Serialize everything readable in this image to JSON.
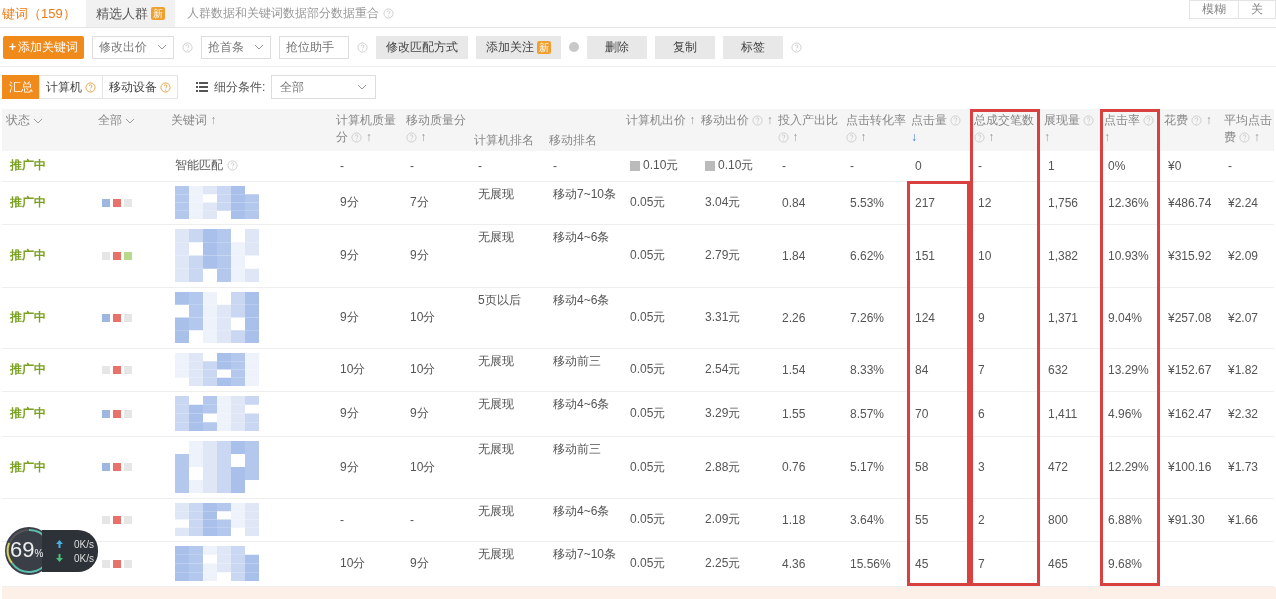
{
  "tabs": [
    {
      "label": "键词（159）",
      "selected": true
    },
    {
      "label": "精选人群",
      "selected": false,
      "badge": "新"
    }
  ],
  "tab_note": "人群数据和关键词数据部分数据重合",
  "match_toggle": [
    {
      "label": "模糊",
      "selected": false
    },
    {
      "label": "关",
      "selected": false
    }
  ],
  "toolbar": [
    {
      "kind": "primary",
      "label": "添加关键词",
      "icon": "+"
    },
    {
      "kind": "dropdown",
      "label": "修改出价"
    },
    {
      "kind": "help"
    },
    {
      "kind": "dropdown",
      "label": "抢首条"
    },
    {
      "kind": "field",
      "placeholder": "抢位助手"
    },
    {
      "kind": "help"
    },
    {
      "kind": "button",
      "label": "修改匹配方式"
    },
    {
      "kind": "button",
      "label": "添加关注",
      "badge": "新"
    },
    {
      "kind": "dot"
    },
    {
      "kind": "button",
      "label": "删除"
    },
    {
      "kind": "button",
      "label": "复制"
    },
    {
      "kind": "button",
      "label": "标签"
    },
    {
      "kind": "help"
    }
  ],
  "device_tabs": [
    {
      "label": "汇总",
      "selected": true,
      "help": false
    },
    {
      "label": "计算机",
      "selected": false,
      "help": true
    },
    {
      "label": "移动设备",
      "selected": false,
      "help": true
    }
  ],
  "filter": {
    "label": "细分条件:",
    "value": "全部"
  },
  "table": {
    "lead_columns": [
      {
        "label": "状态",
        "kind": "dropdown"
      },
      {
        "label": "全部",
        "kind": "dropdown"
      },
      {
        "label": "关键词",
        "sort": "↑"
      }
    ],
    "columns": [
      {
        "label": "计算机质量分",
        "help": true,
        "sort": "↑"
      },
      {
        "label": "移动质量分",
        "help": true,
        "sort": "↑"
      },
      {
        "label": "计算机排名",
        "kind": "sub"
      },
      {
        "label": "移动排名",
        "kind": "sub"
      },
      {
        "label": "计算机出价",
        "sort": "↑"
      },
      {
        "label": "移动出价",
        "help": true,
        "sort": "↑"
      },
      {
        "label": "投入产出比",
        "help": true,
        "sort": "↑"
      },
      {
        "label": "点击转化率",
        "help": true,
        "sort": "↑"
      },
      {
        "label": "点击量",
        "help": true,
        "sort": "↓",
        "sorted": true,
        "highlighted": true,
        "header_highlighted": false
      },
      {
        "label": "总成交笔数",
        "help": true,
        "sort": "↑",
        "highlighted": true,
        "header_highlighted": true
      },
      {
        "label": "展现量",
        "help": true,
        "sort": "↑"
      },
      {
        "label": "点击率",
        "help": true,
        "sort": "↑",
        "highlighted": true,
        "header_highlighted": true
      },
      {
        "label": "花费",
        "help": true,
        "sort": "↑"
      },
      {
        "label": "平均点击费",
        "help": true,
        "sort": "↑"
      }
    ],
    "rows": [
      {
        "status": "推广中",
        "marks": [],
        "keyword": {
          "kind": "text",
          "text": "智能匹配",
          "help": true
        },
        "cells": [
          "-",
          "-",
          "-",
          "-",
          "0.10元",
          "0.10元",
          "-",
          "-",
          "0",
          "-",
          "1",
          "0%",
          "¥0",
          "-"
        ],
        "price_icons": true
      },
      {
        "status": "推广中",
        "marks": [
          {
            "color": "#9fb6e0"
          },
          {
            "color": "#e8726a"
          },
          {
            "color": "#e6e6e6"
          }
        ],
        "keyword": {
          "kind": "blurred"
        },
        "cells": [
          "9分",
          "7分",
          "无展现",
          "移动7~10条",
          "0.05元",
          "3.04元",
          "0.84",
          "5.53%",
          "217",
          "12",
          "1,756",
          "12.36%",
          "¥486.74",
          "¥2.24"
        ]
      },
      {
        "status": "推广中",
        "marks": [
          {
            "color": "#e6e6e6"
          },
          {
            "color": "#e8726a"
          },
          {
            "color": "#b9d98a"
          }
        ],
        "keyword": {
          "kind": "blurred"
        },
        "cells": [
          "9分",
          "9分",
          "无展现",
          "移动4~6条",
          "0.05元",
          "2.79元",
          "1.84",
          "6.62%",
          "151",
          "10",
          "1,382",
          "10.93%",
          "¥315.92",
          "¥2.09"
        ]
      },
      {
        "status": "推广中",
        "marks": [
          {
            "color": "#9fb6e0"
          },
          {
            "color": "#e8726a"
          },
          {
            "color": "#e6e6e6"
          }
        ],
        "keyword": {
          "kind": "blurred"
        },
        "cells": [
          "9分",
          "10分",
          "5页以后",
          "移动4~6条",
          "0.05元",
          "3.31元",
          "2.26",
          "7.26%",
          "124",
          "9",
          "1,371",
          "9.04%",
          "¥257.08",
          "¥2.07"
        ]
      },
      {
        "status": "推广中",
        "marks": [
          {
            "color": "#e6e6e6"
          },
          {
            "color": "#e8726a"
          },
          {
            "color": "#e6e6e6"
          }
        ],
        "keyword": {
          "kind": "blurred"
        },
        "cells": [
          "10分",
          "10分",
          "无展现",
          "移动前三",
          "0.05元",
          "2.54元",
          "1.54",
          "8.33%",
          "84",
          "7",
          "632",
          "13.29%",
          "¥152.67",
          "¥1.82"
        ]
      },
      {
        "status": "推广中",
        "marks": [
          {
            "color": "#9fb6e0"
          },
          {
            "color": "#e8726a"
          },
          {
            "color": "#e6e6e6"
          }
        ],
        "keyword": {
          "kind": "blurred"
        },
        "cells": [
          "9分",
          "9分",
          "无展现",
          "移动4~6条",
          "0.05元",
          "3.29元",
          "1.55",
          "8.57%",
          "70",
          "6",
          "1,411",
          "4.96%",
          "¥162.47",
          "¥2.32"
        ]
      },
      {
        "status": "推广中",
        "marks": [
          {
            "color": "#9fb6e0"
          },
          {
            "color": "#e8726a"
          },
          {
            "color": "#e6e6e6"
          }
        ],
        "keyword": {
          "kind": "blurred"
        },
        "cells": [
          "9分",
          "10分",
          "无展现",
          "移动前三",
          "0.05元",
          "2.88元",
          "0.76",
          "5.17%",
          "58",
          "3",
          "472",
          "12.29%",
          "¥100.16",
          "¥1.73"
        ]
      },
      {
        "marks": [
          {
            "color": "#e6e6e6"
          },
          {
            "color": "#e8726a"
          },
          {
            "color": "#e6e6e6"
          }
        ],
        "keyword": {
          "kind": "blurred"
        },
        "cells": [
          "-",
          "-",
          "无展现",
          "移动4~6条",
          "0.05元",
          "2.09元",
          "1.18",
          "3.64%",
          "55",
          "2",
          "800",
          "6.88%",
          "¥91.30",
          "¥1.66"
        ]
      },
      {
        "marks": [
          {
            "color": "#e6e6e6"
          },
          {
            "color": "#e8726a"
          },
          {
            "color": "#e6e6e6"
          }
        ],
        "keyword": {
          "kind": "blurred"
        },
        "cells": [
          "10分",
          "9分",
          "无展现",
          "移动7~10条",
          "0.05元",
          "2.25元",
          "4.36",
          "15.56%",
          "45",
          "7",
          "465",
          "9.68%"
        ]
      }
    ]
  },
  "net_widget": {
    "percent": "69",
    "unit": "%",
    "up": "0K/s",
    "down": "0K/s"
  }
}
